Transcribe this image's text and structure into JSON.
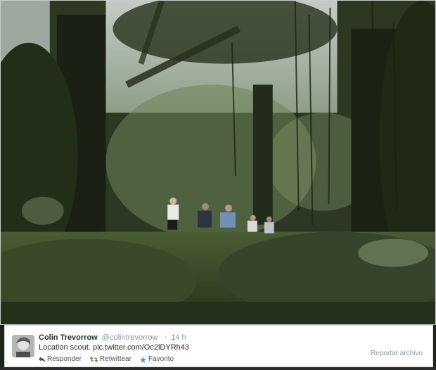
{
  "tweet": {
    "display_name": "Colin Trevorrow",
    "handle": "@colintrevorrow",
    "separator": "·",
    "time": "14 h",
    "text": "Location scout. pic.twitter.com/Oc2lDYRh43",
    "report_label": "Reportar archivo",
    "actions": {
      "reply": "Responder",
      "retweet": "Retwittear",
      "favorite": "Favorito"
    }
  },
  "colors": {
    "name": "#292f33",
    "meta": "#8899a6",
    "reply_icon": "#4c5257",
    "retweet_icon": "#5c913b",
    "favorite_icon": "#3b94d9"
  },
  "icons": {
    "reply": "reply-icon",
    "retweet": "retweet-icon",
    "favorite": "star-icon"
  }
}
